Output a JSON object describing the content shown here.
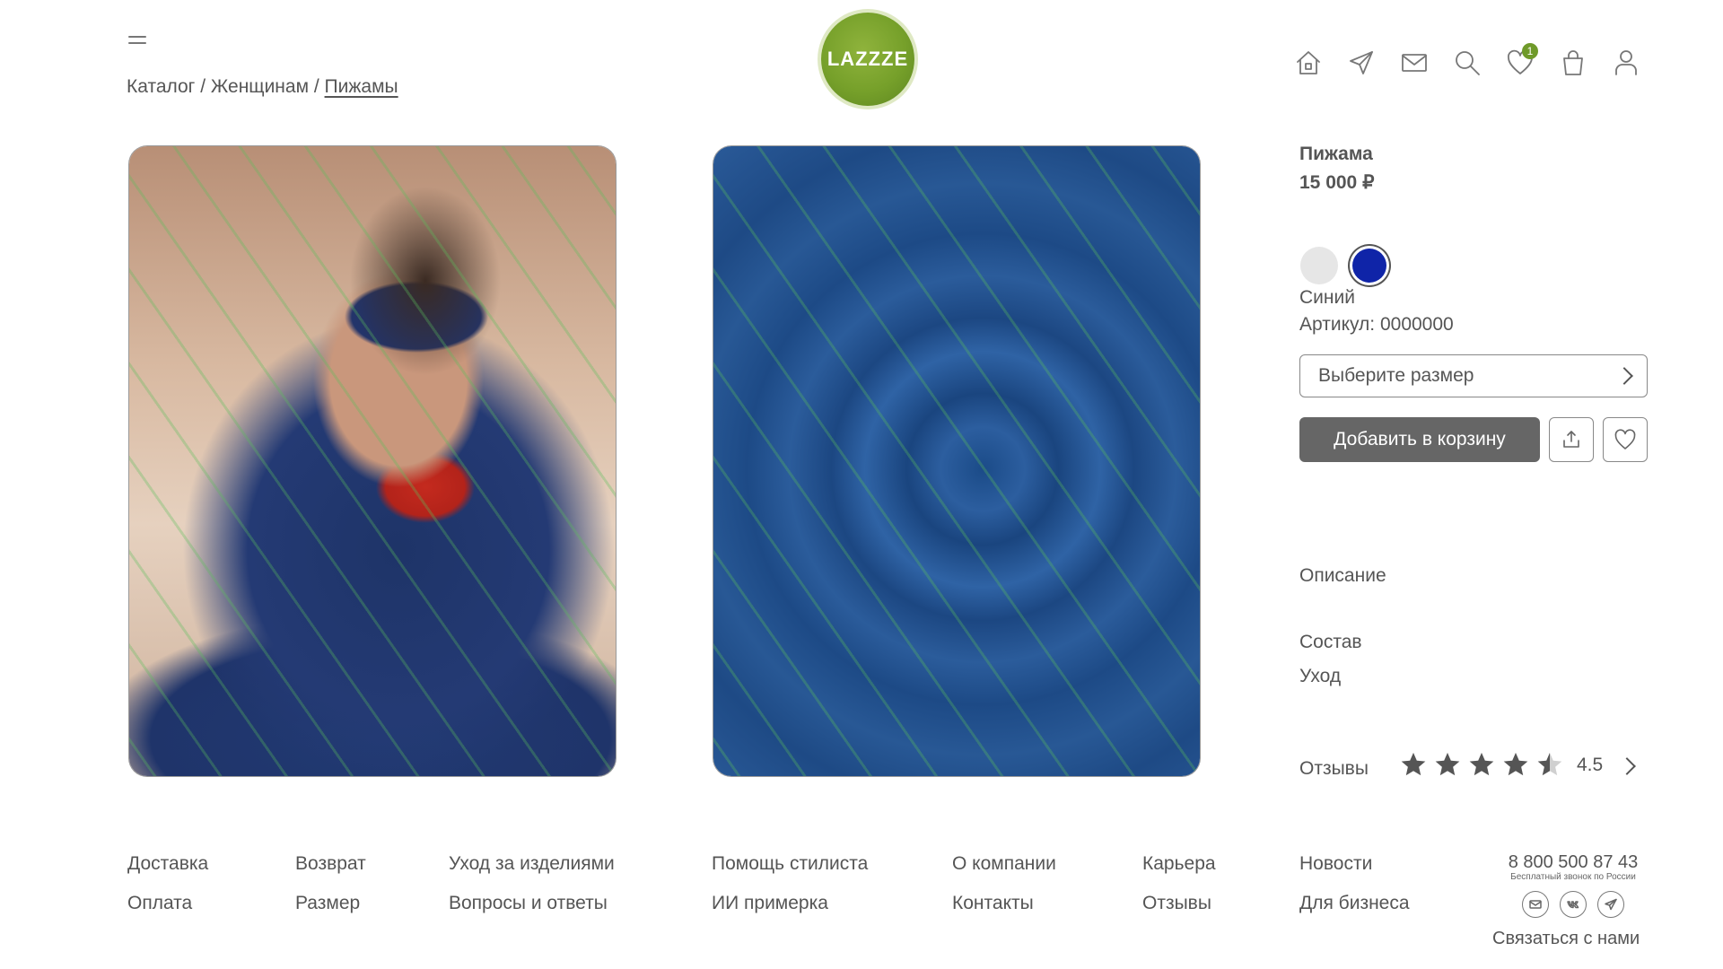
{
  "header": {
    "menu_icon": "hamburger-icon",
    "logo_text": "LAZZZE",
    "breadcrumb": [
      {
        "label": "Каталог"
      },
      {
        "label": "Женщинам"
      },
      {
        "label": "Пижамы"
      }
    ],
    "breadcrumb_separator": "/",
    "icons": [
      "home-icon",
      "send-icon",
      "mail-icon",
      "search-icon",
      "heart-icon",
      "bag-icon",
      "user-icon"
    ],
    "wishlist_count": "1",
    "accent_color": "#76a02a"
  },
  "product": {
    "title": "Пижама",
    "price": "15 000 ₽",
    "colors": [
      {
        "name": "white",
        "hex": "#e6e6e6"
      },
      {
        "name": "blue",
        "hex": "#0f24a8"
      }
    ],
    "selected_color": "Синий",
    "sku": "Артикул: 0000000",
    "size_placeholder": "Выберите размер",
    "add_to_cart": "Добавить в корзину",
    "accordion": {
      "description": "Описание",
      "composition": "Состав",
      "care": "Уход"
    },
    "reviews_label": "Отзывы",
    "rating": 4.5,
    "rating_text": "4.5",
    "max_stars": 5
  },
  "footer": {
    "col1": [
      "Доставка",
      "Оплата"
    ],
    "col2": [
      "Возврат",
      "Размер"
    ],
    "col3": [
      "Уход за изделиями",
      "Вопросы и ответы"
    ],
    "col4": [
      "Помощь стилиста",
      "ИИ примерка"
    ],
    "col5": [
      "О компании",
      "Контакты"
    ],
    "col6": [
      "Карьера",
      "Отзывы"
    ],
    "col7": [
      "Новости",
      "Для бизнеса"
    ],
    "phone": "8 800 500 87 43",
    "phone_note": "Бесплатный звонок по России",
    "social_icons": [
      "mail-icon",
      "vk-icon",
      "telegram-icon"
    ],
    "contact_us": "Связаться с нами"
  }
}
